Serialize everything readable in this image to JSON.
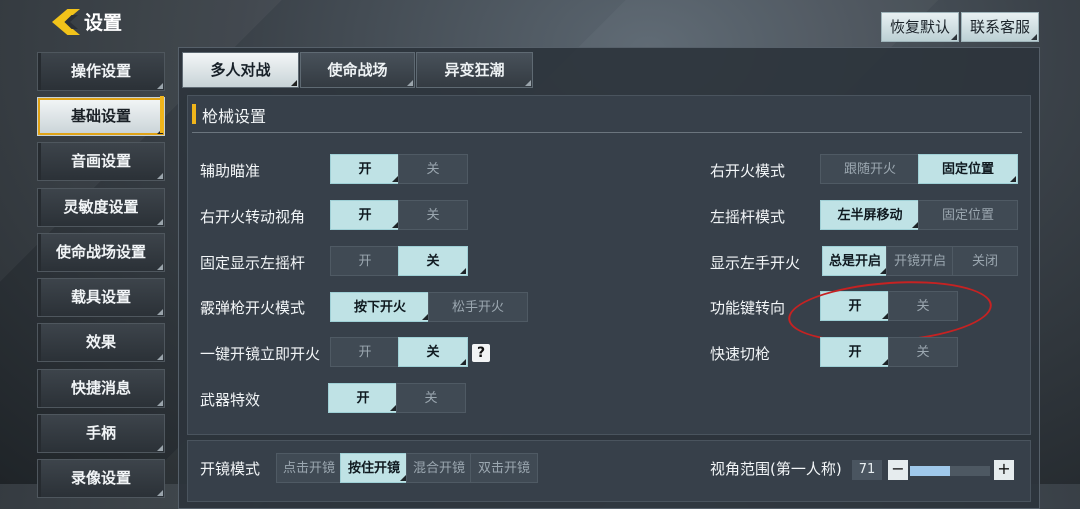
{
  "header": {
    "title": "设置",
    "restore_default": "恢复默认",
    "contact_support": "联系客服"
  },
  "sidebar": {
    "items": [
      {
        "label": "操作设置"
      },
      {
        "label": "基础设置"
      },
      {
        "label": "音画设置"
      },
      {
        "label": "灵敏度设置"
      },
      {
        "label": "使命战场设置"
      },
      {
        "label": "载具设置"
      },
      {
        "label": "效果"
      },
      {
        "label": "快捷消息"
      },
      {
        "label": "手柄"
      },
      {
        "label": "录像设置"
      }
    ]
  },
  "tabs": [
    {
      "label": "多人对战"
    },
    {
      "label": "使命战场"
    },
    {
      "label": "异变狂潮"
    }
  ],
  "section": {
    "title": "枪械设置"
  },
  "left_settings": [
    {
      "label": "辅助瞄准",
      "opt1": "开",
      "opt2": "关"
    },
    {
      "label": "右开火转动视角",
      "opt1": "开",
      "opt2": "关"
    },
    {
      "label": "固定显示左摇杆",
      "opt1": "开",
      "opt2": "关"
    },
    {
      "label": "霰弹枪开火模式",
      "opt1": "按下开火",
      "opt2": "松手开火"
    },
    {
      "label": "一键开镜立即开火",
      "opt1": "开",
      "opt2": "关"
    },
    {
      "label": "武器特效",
      "opt1": "开",
      "opt2": "关"
    }
  ],
  "right_settings": [
    {
      "label": "右开火模式",
      "opt1": "跟随开火",
      "opt2": "固定位置"
    },
    {
      "label": "左摇杆模式",
      "opt1": "左半屏移动",
      "opt2": "固定位置"
    },
    {
      "label": "显示左手开火",
      "opt1": "总是开启",
      "opt2": "开镜开启",
      "opt3": "关闭"
    },
    {
      "label": "功能键转向",
      "opt1": "开",
      "opt2": "关"
    },
    {
      "label": "快速切枪",
      "opt1": "开",
      "opt2": "关"
    }
  ],
  "help_icon": "?",
  "bottom": {
    "scope_label": "开镜模式",
    "scope_opts": [
      "点击开镜",
      "按住开镜",
      "混合开镜",
      "双击开镜"
    ],
    "fov_label": "视角范围(第一人称)",
    "fov_value": "71",
    "minus": "−",
    "plus": "+"
  }
}
